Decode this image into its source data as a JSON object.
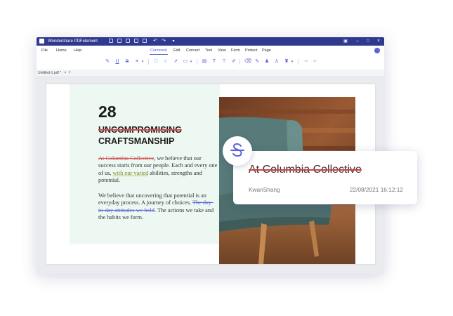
{
  "titlebar": {
    "app_title": "Wondershare PDFelement"
  },
  "menu": {
    "items": [
      "File",
      "Home",
      "Help",
      "Comment",
      "Edit",
      "Convert",
      "Tool",
      "View",
      "Form",
      "Protect",
      "Page"
    ],
    "active": "Comment"
  },
  "tab": {
    "label": "Untitled-1.pdf *",
    "close": "×",
    "add": "+"
  },
  "document": {
    "number": "28",
    "heading_line1": "UNCOMPROMISING",
    "heading_line2": "CRAFTSMANSHIP",
    "para1": {
      "struck": "At Columbia Collective",
      "text1": ", we believe that our success starts from our people. Each and every one of us, ",
      "underlined": "with our varied",
      "text2": " abilities, strengths and potential."
    },
    "para2": {
      "text1": "We believe that uncovering that potential is an everyday process. A journey of choices. ",
      "struck": "The day-to-day attitudes we hold",
      "text2": ". The actions we take and the habits we form."
    }
  },
  "comment_popup": {
    "quote": "At Columbia Collective",
    "author": "KwanShang",
    "timestamp": "22/08/2021 16:12:12",
    "icon": "strikethrough-icon"
  },
  "colors": {
    "brand": "#2f3a8f",
    "accent": "#5b63d8",
    "strike_red": "#d64040",
    "mint_bg": "#eef8f3"
  }
}
